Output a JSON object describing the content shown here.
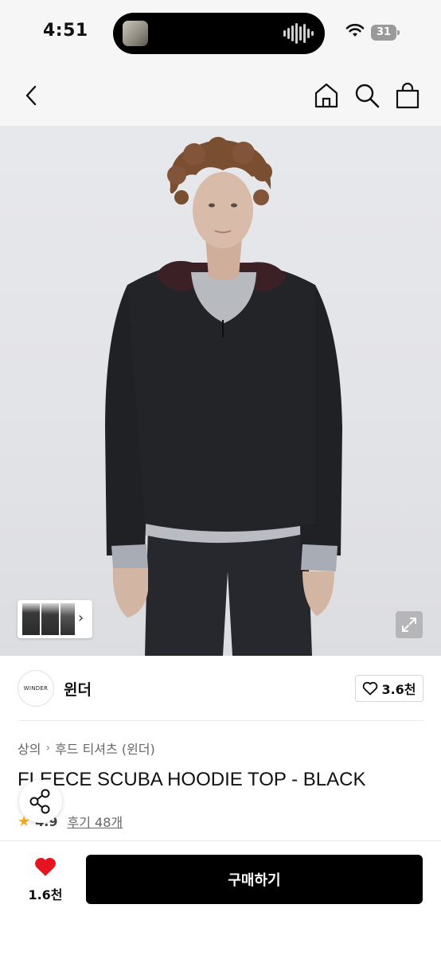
{
  "status_bar": {
    "time": "4:51",
    "battery": "31"
  },
  "brand": {
    "logo_text": "WINDER",
    "name": "윈더",
    "like_count": "3.6천"
  },
  "breadcrumb": {
    "level1": "상의",
    "level2": "후드 티셔츠 (윈더)"
  },
  "product": {
    "title": "FLEECE SCUBA HOODIE TOP - BLACK"
  },
  "rating": {
    "value": "4.9",
    "reviews": "후기 48개"
  },
  "bottom": {
    "wish_count": "1.6천",
    "buy_label": "구매하기"
  },
  "colors": {
    "accent_heart": "#e5141f",
    "star": "#f5a623",
    "buy_button": "#000000"
  },
  "icons": [
    "chevron-left-icon",
    "home-icon",
    "search-icon",
    "shopping-bag-icon",
    "chevron-right-icon",
    "expand-icon",
    "heart-outline-icon",
    "star-icon",
    "share-icon",
    "heart-filled-icon",
    "wifi-icon",
    "battery-icon"
  ]
}
